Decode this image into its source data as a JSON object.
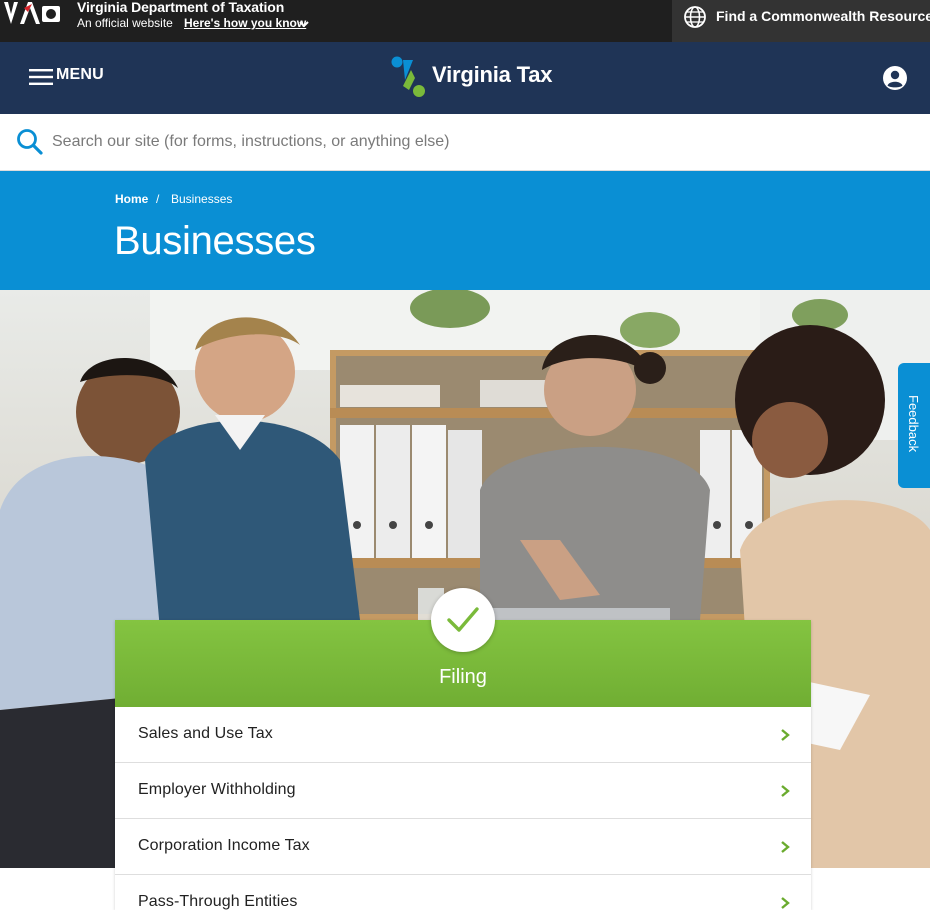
{
  "official_banner": {
    "agency_name": "Virginia Department of Taxation",
    "official_text": "An official website",
    "how_you_know_link": "Here's how you know",
    "resource_button": "Find a Commonwealth Resource"
  },
  "header": {
    "menu_label": "MENU",
    "brand_name": "Virginia Tax"
  },
  "search": {
    "placeholder": "Search our site (for forms, instructions, or anything else)"
  },
  "breadcrumb": {
    "home": "Home",
    "separator": "/",
    "current": "Businesses"
  },
  "page": {
    "title": "Businesses"
  },
  "feedback": {
    "label": "Feedback"
  },
  "filing": {
    "title": "Filing",
    "items": [
      {
        "label": "Sales and Use Tax"
      },
      {
        "label": "Employer Withholding"
      },
      {
        "label": "Corporation Income Tax"
      },
      {
        "label": "Pass-Through Entities"
      }
    ]
  },
  "colors": {
    "header_navy": "#1f3456",
    "banner_blue": "#0a8fd4",
    "filing_green": "#7aba3a",
    "gov_bar": "#1f1f1f"
  },
  "icons": [
    "virginia-seal-logo",
    "chevron-down-icon",
    "globe-icon",
    "hamburger-menu-icon",
    "virginia-tax-logo-mark",
    "account-icon",
    "search-icon",
    "check-icon",
    "chevron-right-icon"
  ]
}
